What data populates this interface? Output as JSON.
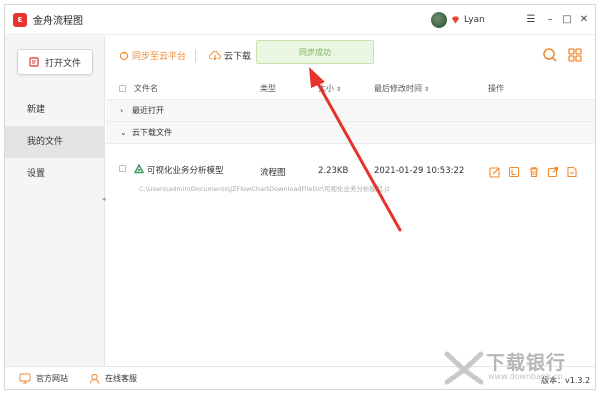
{
  "app": {
    "title": "金舟流程图",
    "user_name": "Lyan",
    "logo_glyph": "ε",
    "controls": {
      "menu": "☰",
      "minimize": "–",
      "maximize": "□",
      "close": "✕"
    }
  },
  "sidebar": {
    "open_file": "打开文件",
    "items": [
      {
        "label": "新建"
      },
      {
        "label": "我的文件"
      },
      {
        "label": "设置"
      }
    ]
  },
  "toolbar": {
    "sync_label": "同步至云平台",
    "download_label": "云下载",
    "toast": "同步成功"
  },
  "table": {
    "headers": {
      "name": "文件名",
      "type": "类型",
      "size": "大小",
      "modified": "最后修改时间",
      "actions": "操作"
    },
    "groups": [
      {
        "label": "最近打开",
        "chevron": "›"
      },
      {
        "label": "云下载文件",
        "chevron": "⌄"
      }
    ],
    "rows": [
      {
        "name": "可视化业务分析模型",
        "type": "流程图",
        "size": "2.23KB",
        "modified": "2021-01-29 10:53:22",
        "path": "C:\\Users\\admin\\Documents\\JZFlowChartDownloadFileDir\\可视化业务分析模型.jz"
      }
    ]
  },
  "footer": {
    "website": "官方网站",
    "service": "在线客服",
    "version": "版本：v1.3.2"
  },
  "watermark": {
    "text": "下载银行",
    "url": "www.downbank.cn"
  },
  "colors": {
    "accent": "#e8332e",
    "orange": "#f08a30",
    "toast_bg": "#eaf6e1",
    "toast_text": "#7fb35a",
    "arrow": "#e5322d"
  }
}
